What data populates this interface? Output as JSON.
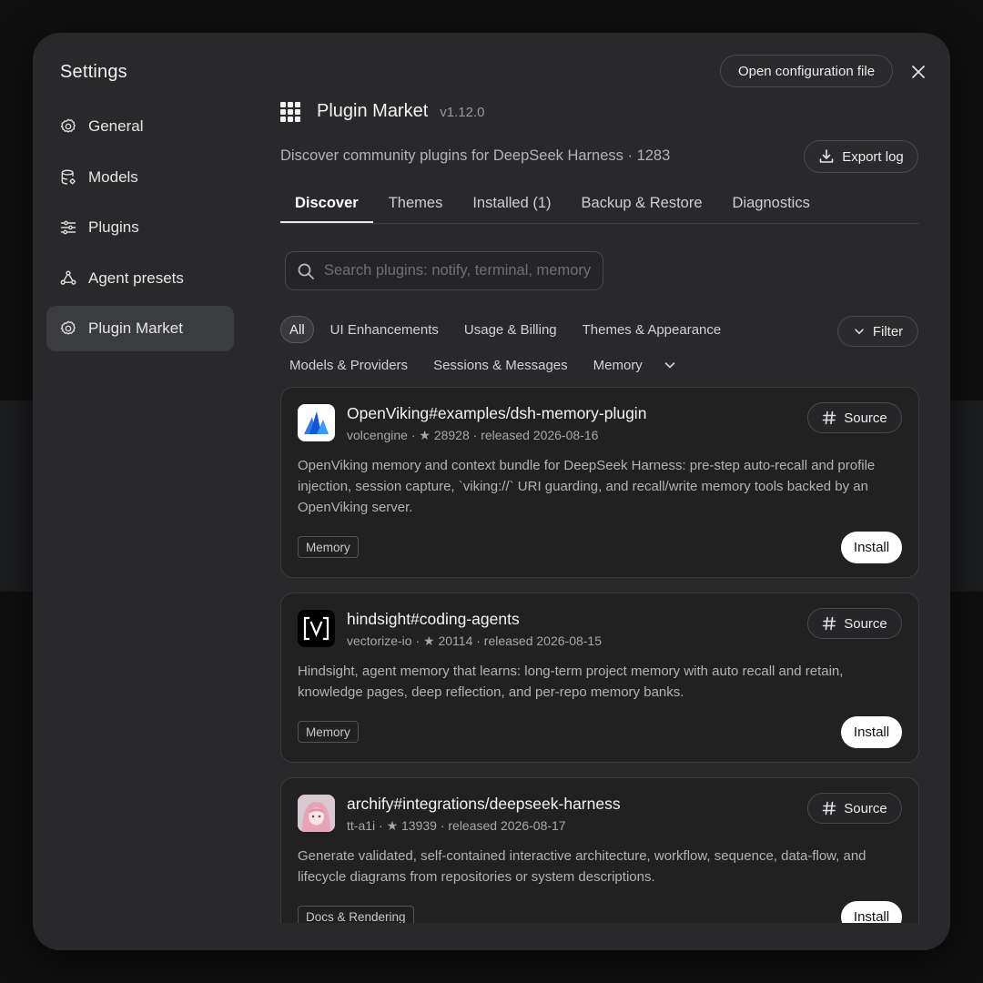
{
  "sidebar": {
    "title": "Settings",
    "items": [
      {
        "label": "General",
        "icon": "gear-icon"
      },
      {
        "label": "Models",
        "icon": "database-icon"
      },
      {
        "label": "Plugins",
        "icon": "sliders-icon"
      },
      {
        "label": "Agent presets",
        "icon": "agents-icon"
      },
      {
        "label": "Plugin Market",
        "icon": "gear-icon",
        "active": true
      }
    ]
  },
  "header": {
    "open_config_label": "Open configuration file"
  },
  "market": {
    "title": "Plugin Market",
    "version": "v1.12.0",
    "description": "Discover community plugins for DeepSeek Harness · 1283",
    "export_label": "Export log"
  },
  "tabs": [
    {
      "label": "Discover",
      "active": true
    },
    {
      "label": "Themes"
    },
    {
      "label": "Installed (1)"
    },
    {
      "label": "Backup & Restore"
    },
    {
      "label": "Diagnostics"
    }
  ],
  "search": {
    "placeholder": "Search plugins: notify, terminal, memory",
    "value": ""
  },
  "chips": {
    "row1": [
      "All",
      "UI Enhancements",
      "Usage & Billing",
      "Themes & Appearance"
    ],
    "row2": [
      "Models & Providers",
      "Sessions & Messages",
      "Memory"
    ],
    "filter_label": "Filter"
  },
  "plugins": [
    {
      "name": "OpenViking#examples/dsh-memory-plugin",
      "meta": "volcengine · ★ 28928 · released 2026-08-16",
      "description": "OpenViking memory and context bundle for DeepSeek Harness: pre-step auto-recall and profile injection, session capture, `viking://` URI guarding, and recall/write memory tools backed by an OpenViking server.",
      "tag": "Memory",
      "source_label": "Source",
      "install_label": "Install"
    },
    {
      "name": "hindsight#coding-agents",
      "meta": "vectorize-io · ★ 20114 · released 2026-08-15",
      "description": "Hindsight, agent memory that learns: long-term project memory with auto recall and retain, knowledge pages, deep reflection, and per-repo memory banks.",
      "tag": "Memory",
      "source_label": "Source",
      "install_label": "Install",
      "icon_text": "[V]"
    },
    {
      "name": "archify#integrations/deepseek-harness",
      "meta": "tt-a1i · ★ 13939 · released 2026-08-17",
      "description": "Generate validated, self-contained interactive architecture, workflow, sequence, data-flow, and lifecycle diagrams from repositories or system descriptions.",
      "tag": "Docs & Rendering",
      "source_label": "Source",
      "install_label": "Install"
    }
  ]
}
